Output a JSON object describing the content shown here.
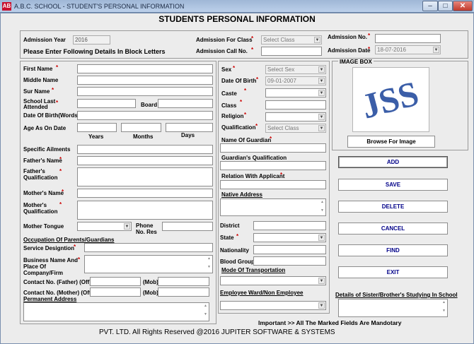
{
  "window": {
    "title": "A.B.C. SCHOOL - STUDENT'S PERSONAL INFORMATION",
    "icon_text": "AB",
    "controls": {
      "minimize": "–",
      "maximize": "□",
      "close": "✕"
    }
  },
  "heading": "STUDENTS PERSONAL INFORMATION",
  "top": {
    "admission_year_label": "Admission Year",
    "admission_year_value": "2016",
    "admission_for_class_label": "Admission For Class",
    "admission_for_class_value": "Select Class",
    "admission_no_label": "Admission No.",
    "admission_call_no_label": "Admission Call No.",
    "admission_date_label": "Admission Date",
    "admission_date_value": "18-07-2016",
    "instruction": "Please Enter Following Details In Block Letters"
  },
  "left": {
    "first_name": "First Name",
    "middle_name": "Middle Name",
    "sur_name": "Sur Name",
    "school_last_attended": "School Last Attended",
    "board": "Board",
    "dob_words": "Date Of Birth(Words)",
    "age_as_on_date": "Age As On Date",
    "years": "Years",
    "months": "Months",
    "days": "Days",
    "specific_ailments": "Specific Ailments",
    "fathers_name": "Father's Name",
    "fathers_qualification": "Father's Qualification",
    "mothers_name": "Mother's Name",
    "mothers_qualification": "Mother's Qualification",
    "mother_tongue": "Mother Tongue",
    "phone_no_res": "Phone No. Res",
    "occupation_heading": "Occupation Of Parents/Guardians",
    "service_designation": "Service Designtion",
    "business_name": "Business Name And Place Of Company/Firm",
    "contact_father": "Contact No. (Father) (Off)",
    "contact_mother": "Contact No. (Mother) (Off)",
    "mob": "(Mob)",
    "permanent_address": "Permanent Address"
  },
  "middle": {
    "sex": "Sex",
    "sex_value": "Select Sex",
    "dob": "Date Of Birth",
    "dob_value": "09-01-2007",
    "caste": "Caste",
    "class": "Class",
    "religion": "Religion",
    "qualification": "Qualification",
    "qualification_value": "Select Class",
    "name_of_guardian": "Name Of Guardian",
    "guardians_qualification": "Guardian's Qualification",
    "relation_with_applicant": "Relation With Applicant",
    "native_address": "Native Address",
    "district": "District",
    "state": "State",
    "nationality": "Nationality",
    "blood_group": "Blood Group",
    "mode_of_transportation": "Mode Of Transportation",
    "employee_ward": "Employee Ward/Non Employee"
  },
  "right": {
    "image_box_label": "IMAGE BOX",
    "logo_text": "JSS",
    "browse_button": "Browse For Image",
    "actions": [
      "ADD",
      "SAVE",
      "DELETE",
      "CANCEL",
      "FIND",
      "EXIT"
    ],
    "sister_brother_details": "Details of Sister/Brother's Studying In School"
  },
  "important_text": "Important >>   All The Marked Fields Are Mandotary",
  "footer": "PVT. LTD. All Rights Reserved @2016 JUPITER SOFTWARE & SYSTEMS",
  "required_mark": "*",
  "colors": {
    "titlebar": "#bcd0ea",
    "frame": "#ececec",
    "logo": "#3b5ea8",
    "action_text": "#000088",
    "required": "#cc0000"
  }
}
